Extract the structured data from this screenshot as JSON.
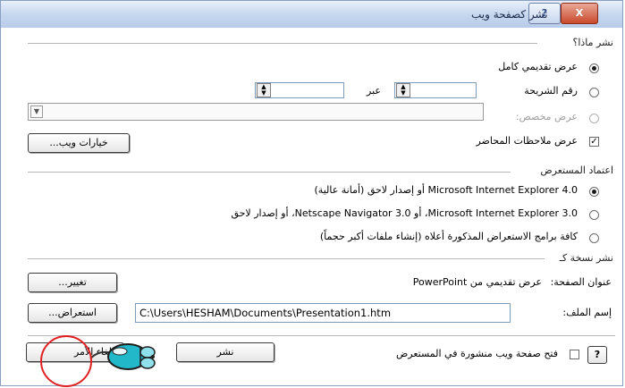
{
  "window": {
    "title": "نشر كصفحة ويب",
    "help_button": "?",
    "close_button": "X"
  },
  "publish_what": {
    "section_title": "نشر ماذا؟",
    "complete_presentation": "عرض تقديمي كامل",
    "slide_number": "رقم الشريحة",
    "through": "عبر",
    "custom_show": "عرض مخصص:",
    "speaker_notes": "عرض ملاحظات المحاضر",
    "web_options_button": "خيارات ويب..."
  },
  "browser_support": {
    "section_title": "اعتماد المستعرض",
    "ie4": "Microsoft Internet Explorer 4.0 أو إصدار لاحق (أمانة عالية)",
    "ie3": "Microsoft Internet Explorer 3.0، أو Netscape Navigator 3.0، أو إصدار لاحق",
    "all_browsers": "كافة برامج الاستعراض المذكورة أعلاه (إنشاء ملفات أكبر حجماً)"
  },
  "publish_copy": {
    "section_title": "نشر نسخة كـ",
    "page_title_label": "عنوان الصفحة:",
    "page_title_value": "عرض تقديمي من PowerPoint",
    "change_button": "تغيير...",
    "file_name_label": "إسم الملف:",
    "file_name_value": "C:\\Users\\HESHAM\\Documents\\Presentation1.htm",
    "browse_button": "استعراض..."
  },
  "footer": {
    "help_button": "?",
    "open_in_browser": "فتح صفحة ويب منشورة في المستعرض",
    "publish_button": "نشر",
    "cancel_button": "إلغاء الأمر"
  }
}
